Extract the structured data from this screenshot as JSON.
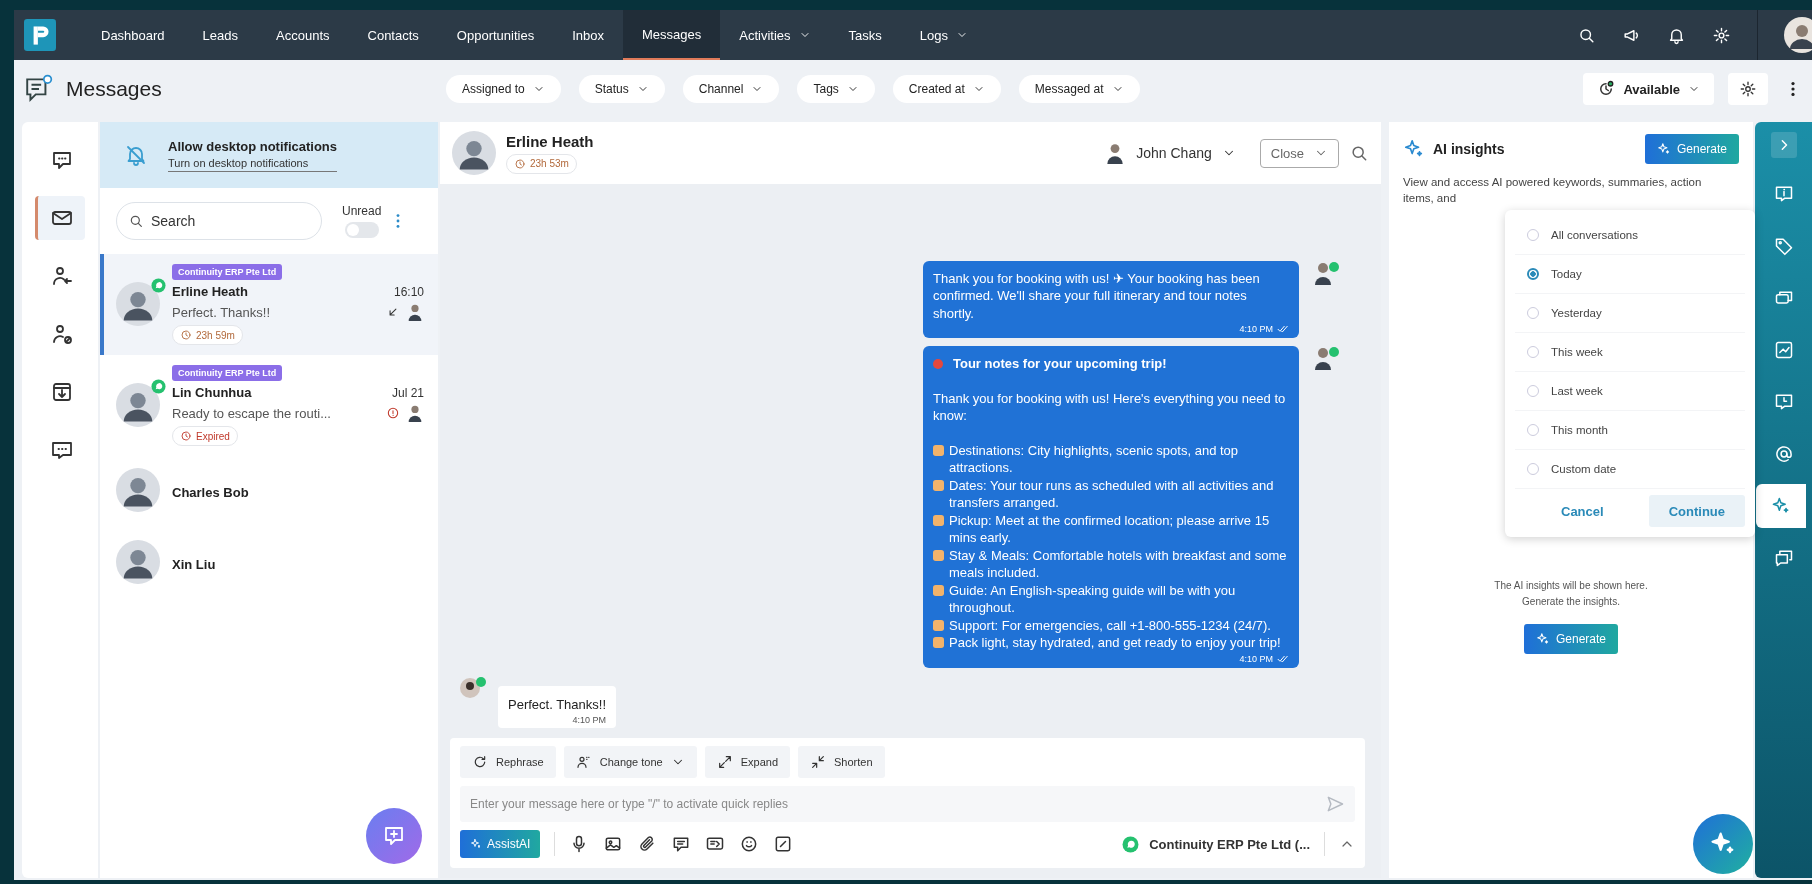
{
  "nav": {
    "items": [
      {
        "label": "Dashboard",
        "selected": false,
        "dropdown": false
      },
      {
        "label": "Leads",
        "selected": false,
        "dropdown": false
      },
      {
        "label": "Accounts",
        "selected": false,
        "dropdown": false
      },
      {
        "label": "Contacts",
        "selected": false,
        "dropdown": false
      },
      {
        "label": "Opportunities",
        "selected": false,
        "dropdown": false
      },
      {
        "label": "Inbox",
        "selected": false,
        "dropdown": false
      },
      {
        "label": "Messages",
        "selected": true,
        "dropdown": false
      },
      {
        "label": "Activities",
        "selected": false,
        "dropdown": true
      },
      {
        "label": "Tasks",
        "selected": false,
        "dropdown": false
      },
      {
        "label": "Logs",
        "selected": false,
        "dropdown": true
      }
    ]
  },
  "page_title": "Messages",
  "filters": [
    "Assigned to",
    "Status",
    "Channel",
    "Tags",
    "Created at",
    "Messaged at"
  ],
  "availability": "Available",
  "rail": [
    {
      "kind": "chat",
      "selected": false
    },
    {
      "kind": "mail",
      "selected": true
    },
    {
      "kind": "user-in",
      "selected": false
    },
    {
      "kind": "user-block",
      "selected": false
    },
    {
      "kind": "download",
      "selected": false
    },
    {
      "kind": "chat-dots",
      "selected": false
    }
  ],
  "notification_banner": {
    "title": "Allow desktop notifications",
    "subtitle": "Turn on desktop notifications"
  },
  "search": {
    "placeholder": "Search"
  },
  "unread_toggle": {
    "label": "Unread",
    "on": false
  },
  "conversations": [
    {
      "name": "Erline Heath",
      "tag": "Continuity ERP Pte Ltd",
      "time": "16:10",
      "preview": "Perfect. Thanks!!",
      "timer": "23h 59m",
      "expired": false,
      "failed": false,
      "whatsapp": true,
      "selected": true
    },
    {
      "name": "Lin Chunhua",
      "tag": "Continuity ERP Pte Ltd",
      "time": "Jul 21",
      "preview": "Ready to escape the routi...",
      "timer": "Expired",
      "expired": true,
      "failed": true,
      "whatsapp": true,
      "selected": false
    },
    {
      "name": "Charles Bob",
      "whatsapp": false,
      "selected": false
    },
    {
      "name": "Xin Liu",
      "whatsapp": false,
      "selected": false
    }
  ],
  "chat": {
    "contact": "Erline Heath",
    "timer": "23h 53m",
    "assignee": "John Chang",
    "close_label": "Close",
    "messages": [
      {
        "kind": "sent-text",
        "text": "Thank you for booking with us! ✈ Your booking has been confirmed. We'll share your full itinerary and tour notes shortly.",
        "time": "4:10 PM"
      },
      {
        "kind": "sent-notes",
        "title": "Tour notes for your upcoming trip!",
        "intro": "Thank you for booking with us! Here's everything you need to know:",
        "items": [
          "Destinations: City highlights, scenic spots, and top attractions.",
          "Dates: Your tour runs as scheduled with all activities and transfers arranged.",
          "Pickup: Meet at the confirmed location; please arrive 15 mins early.",
          "Stay & Meals: Comfortable hotels with breakfast and some meals included.",
          "Guide: An English-speaking guide will be with you throughout.",
          "Support: For emergencies, call +1-800-555-1234 (24/7).",
          "Pack light, stay hydrated, and get ready to enjoy your trip!"
        ],
        "time": "4:10 PM"
      },
      {
        "kind": "received-text",
        "text": "Perfect. Thanks!!",
        "time": "4:10 PM"
      }
    ],
    "ai_tools": [
      {
        "kind": "rephrase",
        "label": "Rephrase",
        "dropdown": false
      },
      {
        "kind": "tone",
        "label": "Change tone",
        "dropdown": true
      },
      {
        "kind": "expand",
        "label": "Expand",
        "dropdown": false
      },
      {
        "kind": "shorten",
        "label": "Shorten",
        "dropdown": false
      }
    ],
    "composer": {
      "placeholder": "Enter your message here or type \"/\" to activate quick replies"
    },
    "assist_button": "AssistAI",
    "channel": "Continuity ERP Pte Ltd (..."
  },
  "insights": {
    "title": "AI insights",
    "generate_label": "Generate",
    "description": "View and access AI powered keywords, summaries, action items, and",
    "popup": {
      "options": [
        {
          "label": "All conversations",
          "selected": false
        },
        {
          "label": "Today",
          "selected": true
        },
        {
          "label": "Yesterday",
          "selected": false
        },
        {
          "label": "This week",
          "selected": false
        },
        {
          "label": "Last week",
          "selected": false
        },
        {
          "label": "This month",
          "selected": false
        },
        {
          "label": "Custom date",
          "selected": false
        }
      ],
      "cancel": "Cancel",
      "continue": "Continue"
    },
    "empty_lines": [
      "The AI insights will be shown here.",
      "Generate the insights."
    ],
    "empty_generate": "Generate"
  },
  "right_rail": [
    {
      "kind": "collapse",
      "selected": false
    },
    {
      "kind": "info",
      "selected": false
    },
    {
      "kind": "tag",
      "selected": false
    },
    {
      "kind": "cards",
      "selected": false
    },
    {
      "kind": "chart",
      "selected": false
    },
    {
      "kind": "clock-chat",
      "selected": false
    },
    {
      "kind": "at",
      "selected": false
    },
    {
      "kind": "sparkle",
      "selected": true
    },
    {
      "kind": "chats",
      "selected": false
    }
  ]
}
